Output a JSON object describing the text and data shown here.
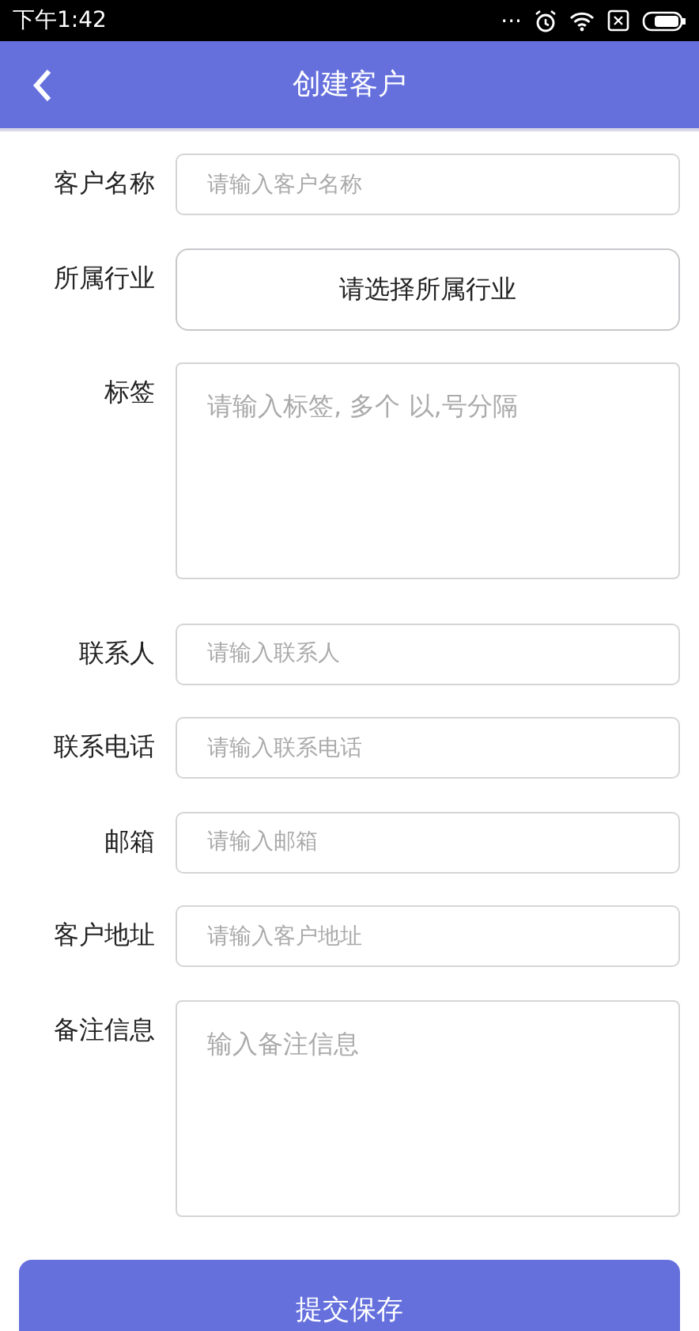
{
  "status_bar": {
    "time": "下午1:42",
    "more": "..."
  },
  "header": {
    "title": "创建客户"
  },
  "fields": [
    {
      "kind": "input",
      "label": "客户名称",
      "placeholder": "请输入客户名称"
    },
    {
      "kind": "select",
      "label": "所属行业",
      "text": "请选择所属行业"
    },
    {
      "kind": "textarea",
      "label": "标签",
      "placeholder": "请输入标签, 多个 以,号分隔"
    },
    {
      "kind": "input",
      "label": "联系人",
      "placeholder": "请输入联系人"
    },
    {
      "kind": "input",
      "label": "联系电话",
      "placeholder": "请输入联系电话"
    },
    {
      "kind": "input",
      "label": "邮箱",
      "placeholder": "请输入邮箱"
    },
    {
      "kind": "input",
      "label": "客户地址",
      "placeholder": "请输入客户地址"
    },
    {
      "kind": "textarea",
      "label": "备注信息",
      "placeholder": "输入备注信息"
    }
  ],
  "submit_button": "提交保存"
}
